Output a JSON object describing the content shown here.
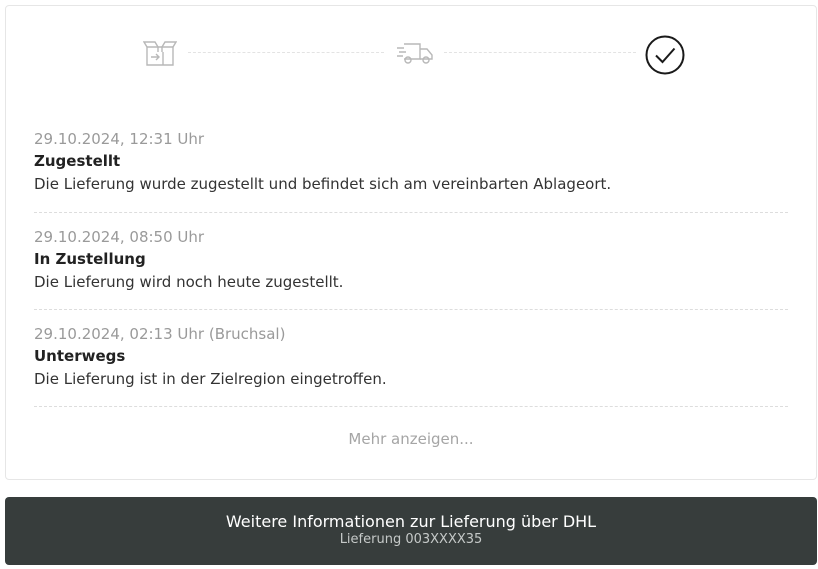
{
  "progress": {
    "steps": [
      {
        "icon": "package-icon",
        "state": "done"
      },
      {
        "icon": "delivery-truck-icon",
        "state": "done"
      },
      {
        "icon": "check-circle-icon",
        "state": "current"
      }
    ]
  },
  "events": [
    {
      "time": "29.10.2024, 12:31 Uhr",
      "title": "Zugestellt",
      "description": "Die Lieferung wurde zugestellt und befindet sich am vereinbarten Ablageort."
    },
    {
      "time": "29.10.2024, 08:50 Uhr",
      "title": "In Zustellung",
      "description": "Die Lieferung wird noch heute zugestellt."
    },
    {
      "time": "29.10.2024, 02:13 Uhr (Bruchsal)",
      "title": "Unterwegs",
      "description": "Die Lieferung ist in der Zielregion eingetroffen."
    }
  ],
  "more_label": "Mehr anzeigen...",
  "dhl_button": {
    "title": "Weitere Informationen zur Lieferung über DHL",
    "subtitle": "Lieferung 003XXXX35"
  },
  "colors": {
    "button_bg": "#373d3c",
    "muted_text": "#9a9a9a",
    "icon_inactive": "#b8b8b8",
    "icon_active": "#1a1a1a"
  }
}
